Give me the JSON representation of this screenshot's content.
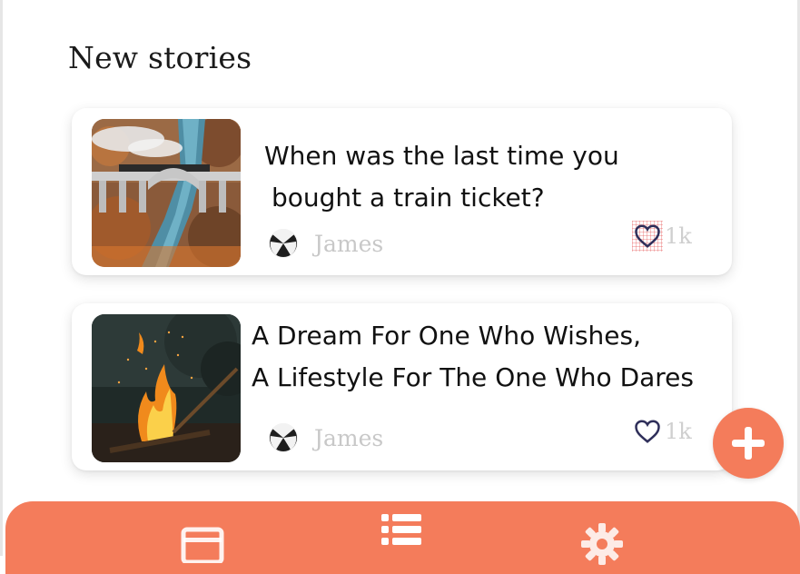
{
  "section": {
    "title": "New stories"
  },
  "stories": [
    {
      "title_line1": "When was the last time you",
      "title_line2": "bought a train ticket?",
      "author": "James",
      "likes": "1k",
      "image": "train-bridge-photo",
      "liked_icon": "heart-outline-icon"
    },
    {
      "title_line1": "A Dream For One Who Wishes,",
      "title_line2": "A Lifestyle For The One Who Dares",
      "author": "James",
      "likes": "1k",
      "image": "campfire-photo",
      "liked_icon": "heart-outline-icon"
    }
  ],
  "fab": {
    "icon": "plus-icon"
  },
  "bottom_nav": {
    "items": [
      "feed-icon",
      "list-icon",
      "gear-icon"
    ]
  },
  "colors": {
    "accent": "#f47c5b",
    "heart": "#2f2f5a",
    "muted_text": "#c8c8c8"
  }
}
